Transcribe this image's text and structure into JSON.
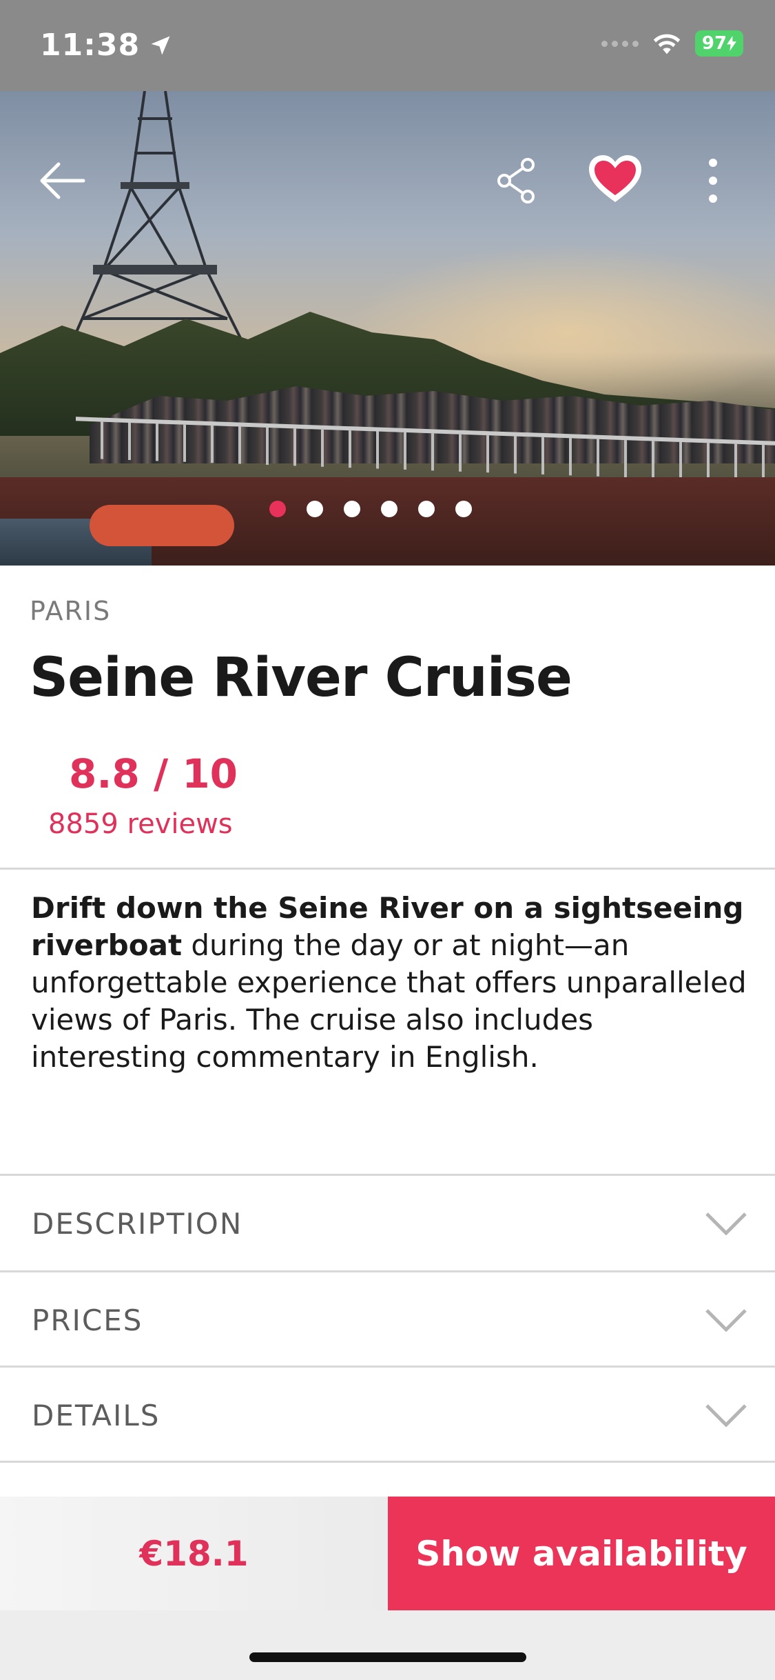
{
  "status_bar": {
    "time": "11:38",
    "battery": "97"
  },
  "header_icons": {
    "back": "arrow-left-icon",
    "share": "share-icon",
    "favorite": "heart-icon",
    "more": "more-vertical-icon"
  },
  "carousel": {
    "total_dots": 6,
    "active_index": 0
  },
  "activity": {
    "city": "PARIS",
    "title": "Seine River Cruise",
    "rating": "8.8 / 10",
    "reviews": "8859 reviews",
    "intro_bold": "Drift down the Seine River on a sightseeing riverboat",
    "intro_rest": " during the day or at night—an unforgettable experience that offers unparalleled views of Paris. The cruise also includes interesting commentary in English."
  },
  "sections": [
    {
      "label": "DESCRIPTION"
    },
    {
      "label": "PRICES"
    },
    {
      "label": "DETAILS"
    }
  ],
  "footer": {
    "price": "€18.1",
    "cta": "Show availability"
  },
  "colors": {
    "accent": "#e8315b",
    "cta_bg": "#ec3358",
    "status_bar_bg": "#8a8a8a",
    "battery": "#4fd36a"
  }
}
